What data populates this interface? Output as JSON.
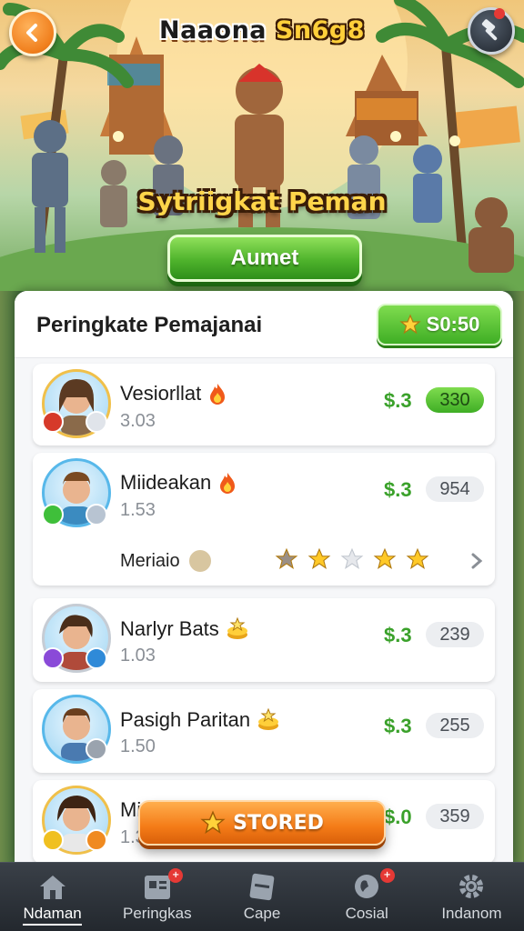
{
  "header": {
    "game_logo_part1": "Naaona ",
    "game_logo_part2": "Sn6g8",
    "hero_title": "Sytriigkat Peman",
    "hero_button": "Aumet"
  },
  "icons": {
    "back": "chevron-left-icon",
    "tools": "hammer-icon",
    "coin": "star-icon",
    "fire": "fire-icon",
    "chevron": "chevron-right-icon"
  },
  "leaderboard": {
    "title": "Peringkate Pemajanai",
    "coins": "S0:50",
    "rows": [
      {
        "name": "Vesiorllat",
        "sub": "3.03",
        "price": "$.3",
        "score": "330",
        "highlight": true,
        "reaction": "fire"
      },
      {
        "name": "Miideakan",
        "sub": "1.53",
        "price": "$.3",
        "score": "954",
        "highlight": false,
        "reaction": "fire",
        "extra_label": "Meriaio",
        "rating": 4
      },
      {
        "name": "Narlyr Bats",
        "sub": "1.03",
        "price": "$.3",
        "score": "239",
        "highlight": false,
        "reaction": "coin"
      },
      {
        "name": "Pasigh Paritan",
        "sub": "1.50",
        "price": "$.3",
        "score": "255",
        "highlight": false,
        "reaction": "coin"
      },
      {
        "name": "Mi",
        "sub": "1.3",
        "price": "$.0",
        "score": "359",
        "highlight": false,
        "reaction": ""
      }
    ]
  },
  "floating_button": "STORED",
  "nav": {
    "items": [
      {
        "label": "Ndaman",
        "active": true
      },
      {
        "label": "Peringkas",
        "badge": "+"
      },
      {
        "label": "Cape"
      },
      {
        "label": "Cosial",
        "badge": "+"
      },
      {
        "label": "Indanom"
      }
    ]
  },
  "colors": {
    "accent_green": "#3fae25",
    "accent_orange": "#f47b17",
    "price_green": "#3aa12a"
  }
}
